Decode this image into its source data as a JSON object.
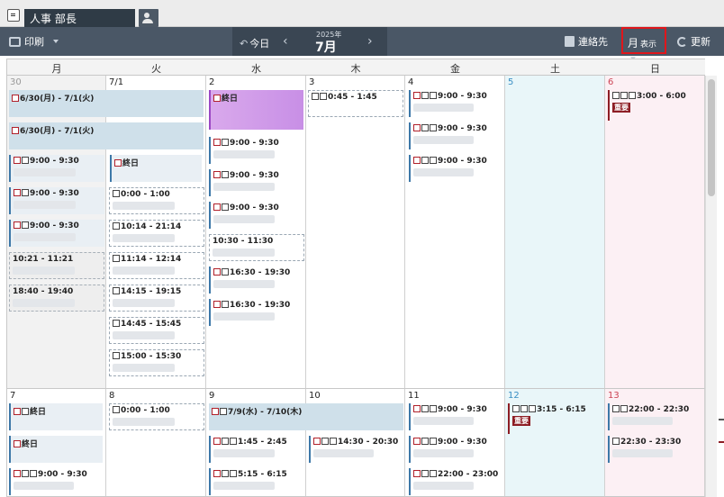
{
  "header": {
    "user_tab": "人事 部長"
  },
  "toolbar": {
    "print": "印刷",
    "today": "今日",
    "year": "2025年",
    "month": "7月",
    "contacts": "連絡先",
    "view": "月",
    "view_small": "表示",
    "refresh": "更新"
  },
  "weekdays": [
    "月",
    "火",
    "水",
    "木",
    "金",
    "土",
    "日"
  ],
  "week1": {
    "days": [
      "30",
      "7/1",
      "2",
      "3",
      "4",
      "5",
      "6"
    ],
    "events": {
      "mon_span1": "6/30(月) - 7/1(火)",
      "mon_span2": "6/30(月) - 7/1(火)",
      "mon_e1": "9:00 - 9:30",
      "mon_e2": "9:00 - 9:30",
      "mon_e3": "9:00 - 9:30",
      "mon_e4": "10:21 - 11:21",
      "mon_e5": "18:40 - 19:40",
      "tue_e1": "終日",
      "tue_e2": "0:00 - 1:00",
      "tue_e3": "10:14 - 21:14",
      "tue_e4": "11:14 - 12:14",
      "tue_e5": "14:15 - 19:15",
      "tue_e6": "14:45 - 15:45",
      "tue_e7": "15:00 - 15:30",
      "wed_e1": "終日",
      "wed_e2": "9:00 - 9:30",
      "wed_e3": "9:00 - 9:30",
      "wed_e4": "9:00 - 9:30",
      "wed_e5": "10:30 - 11:30",
      "wed_e6": "16:30 - 19:30",
      "wed_e7": "16:30 - 19:30",
      "thu_e1": "0:45 - 1:45",
      "fri_e1": "9:00 - 9:30",
      "fri_e2": "9:00 - 9:30",
      "fri_e3": "9:00 - 9:30",
      "sun_e1": "3:00 - 6:00",
      "sun_badge": "重要"
    }
  },
  "week2": {
    "days": [
      "7",
      "8",
      "9",
      "10",
      "11",
      "12",
      "13"
    ],
    "events": {
      "mon_e1": "終日",
      "mon_e2": "終日",
      "mon_e3": "9:00 - 9:30",
      "tue_e1": "0:00 - 1:00",
      "wed_span": "7/9(水) - 7/10(木)",
      "wed_e1": "1:45 - 2:45",
      "wed_e2": "5:15 - 6:15",
      "thu_e1": "14:30 - 20:30",
      "fri_e1": "9:00 - 9:30",
      "fri_e2": "9:00 - 9:30",
      "fri_e3": "22:00 - 23:00",
      "sat_e1": "3:15 - 6:15",
      "sat_badge": "重要",
      "sun_e1": "22:00 - 22:30",
      "sun_e2": "22:30 - 23:30"
    }
  }
}
